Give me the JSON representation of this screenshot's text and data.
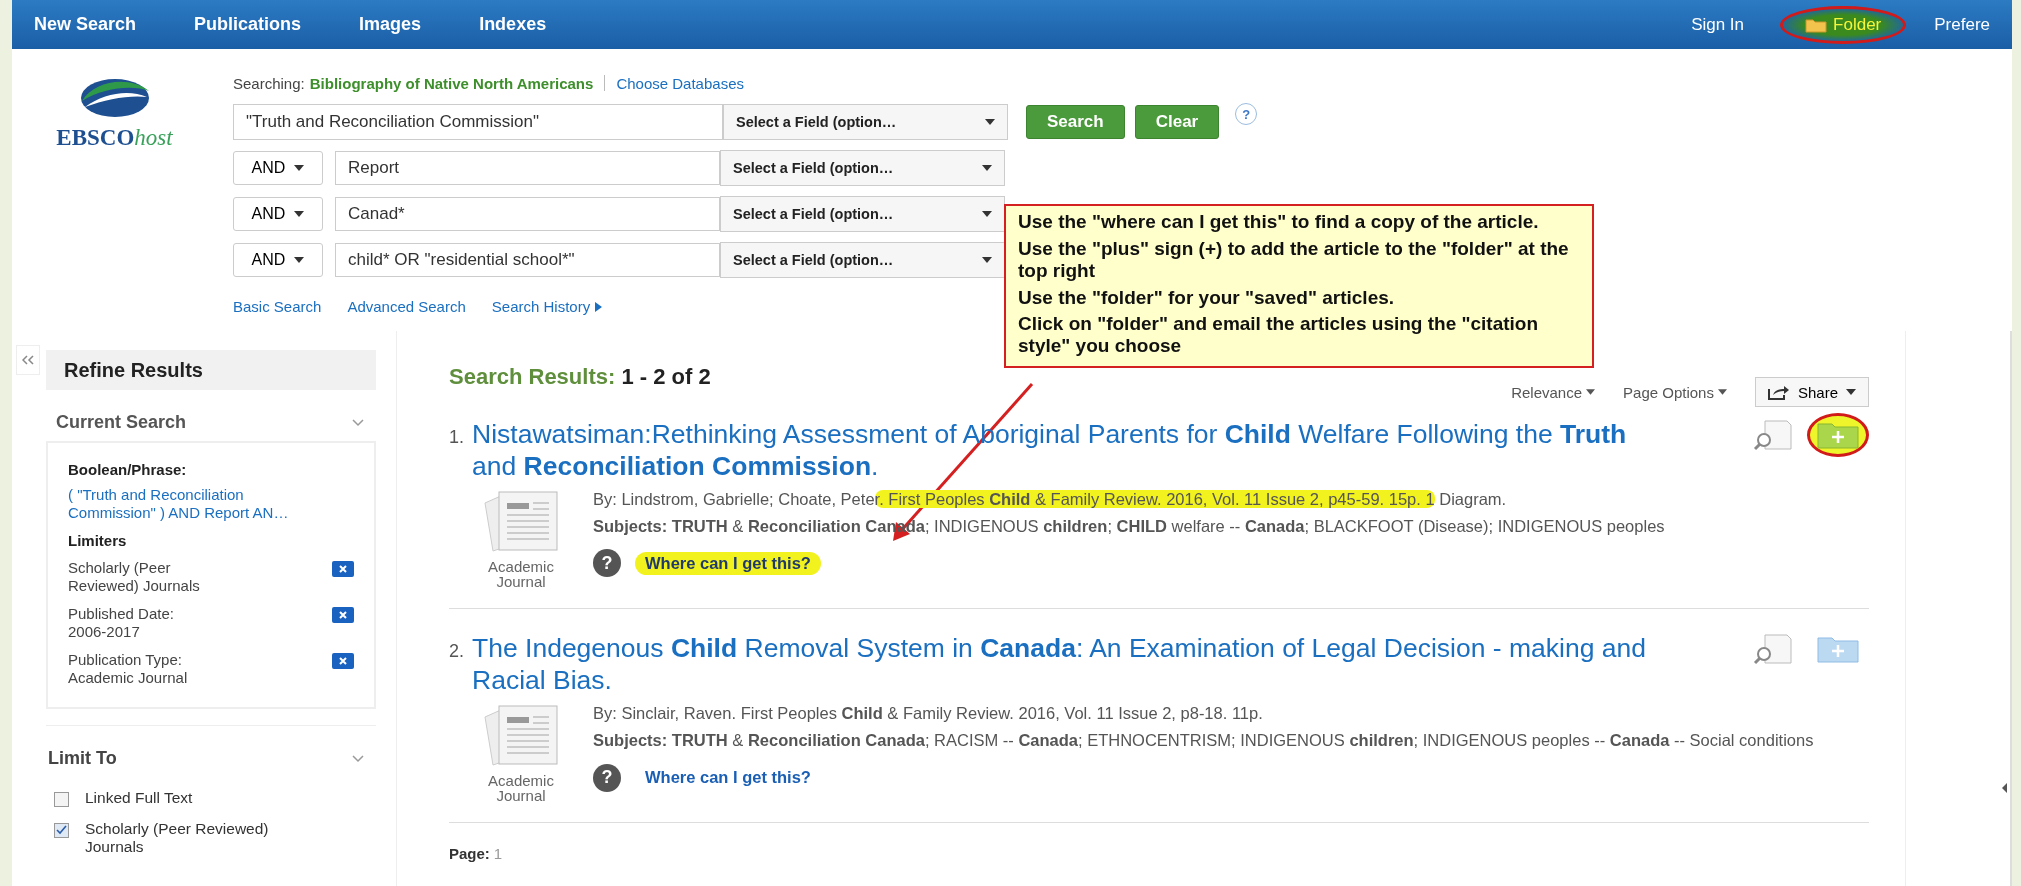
{
  "nav": {
    "items": [
      "New Search",
      "Publications",
      "Images",
      "Indexes"
    ],
    "sign_in": "Sign In",
    "folder": {
      "label": "Folder",
      "highlighted": true,
      "circled": true
    },
    "preferences": "Prefere"
  },
  "logo": {
    "brand": "EBSCO",
    "suffix": "host"
  },
  "search": {
    "searching_label": "Searching:",
    "database": "Bibliography of Native North Americans",
    "choose_databases": "Choose Databases",
    "rows": [
      {
        "value": "\"Truth and Reconciliation Commission\"",
        "field": "Select a Field (option…"
      },
      {
        "operator": "AND",
        "value": "Report",
        "field": "Select a Field (option…"
      },
      {
        "operator": "AND",
        "value": "Canad*",
        "field": "Select a Field (option…"
      },
      {
        "operator": "AND",
        "value": "child* OR \"residential school*\"",
        "field": "Select a Field (option…"
      }
    ],
    "buttons": [
      "Search",
      "Clear"
    ],
    "help": "?",
    "links": [
      "Basic Search",
      "Advanced Search",
      "Search History"
    ]
  },
  "callout": {
    "paragraphs": [
      "Use the \"where can I get this\" to find a copy of the article.",
      "Use the \"plus\" sign (+) to add the article to the \"folder\" at the top right",
      "Use the \"folder\" for your \"saved\" articles.",
      "Click on \"folder\" and email the articles using the \"citation style\" you choose"
    ]
  },
  "sidebar": {
    "title": "Refine Results",
    "current_search": {
      "heading": "Current Search",
      "boolean_label": "Boolean/Phrase:",
      "query": "( \"Truth and Reconciliation Commission\" ) AND Report AN…",
      "limiters_label": "Limiters",
      "limiters": [
        "Scholarly (Peer Reviewed) Journals",
        "Published Date: 2006-2017",
        "Publication Type: Academic Journal"
      ]
    },
    "limit_to": {
      "heading": "Limit To",
      "options": [
        {
          "label": "Linked Full Text",
          "checked": false
        },
        {
          "label": "Scholarly (Peer Reviewed) Journals",
          "checked": true
        }
      ]
    }
  },
  "results": {
    "summary_label": "Search Results:",
    "summary_range": "1 - 2 of 2",
    "sort": "Relevance",
    "page_options": "Page Options",
    "share": "Share",
    "items": [
      {
        "number": "1.",
        "title": "Nistawatsiman:Rethinking Assessment of Aboriginal Parents for **Child** Welfare Following the **Truth** and **Reconciliation Commission**.",
        "type_label": "Academic Journal",
        "byline": [
          {
            "text": "By: Lindstrom, Gabrielle; Choate, Pete",
            "highlighted": false
          },
          {
            "text": "r. First Peoples **Child** & Family Review. 2016, Vol. 11 Issue 2, p45-59. 15p. 1",
            "highlighted": true
          },
          {
            "text": " Diagram.",
            "highlighted": false
          }
        ],
        "subjects": "**Subjects: TRUTH** & **Reconciliation Canada**; INDIGENOUS **children**; **CHILD** welfare -- **Canada**; BLACKFOOT (Disease); INDIGENOUS peoples",
        "where": {
          "icon": "?",
          "label": "Where can I get this?",
          "highlighted": true
        },
        "add_folder": {
          "highlighted": true,
          "circled": true
        }
      },
      {
        "number": "2.",
        "title": "The Indegenous **Child** Removal System in **Canada**: An Examination of Legal Decision - making and Racial Bias.",
        "type_label": "Academic Journal",
        "byline": [
          {
            "text": "By: Sinclair, Raven. First Peoples **Child** & Family Review. 2016, Vol. 11 Issue 2, p8-18. 11p.",
            "highlighted": false
          }
        ],
        "subjects": "**Subjects: TRUTH** & **Reconciliation Canada**; RACISM -- **Canada**; ETHNOCENTRISM; INDIGENOUS **children**; INDIGENOUS peoples -- **Canada** -- Social conditions",
        "where": {
          "icon": "?",
          "label": "Where can I get this?",
          "highlighted": false
        },
        "add_folder": {
          "highlighted": false,
          "circled": false
        }
      }
    ],
    "page_label": "Page:",
    "page_current": "1"
  }
}
